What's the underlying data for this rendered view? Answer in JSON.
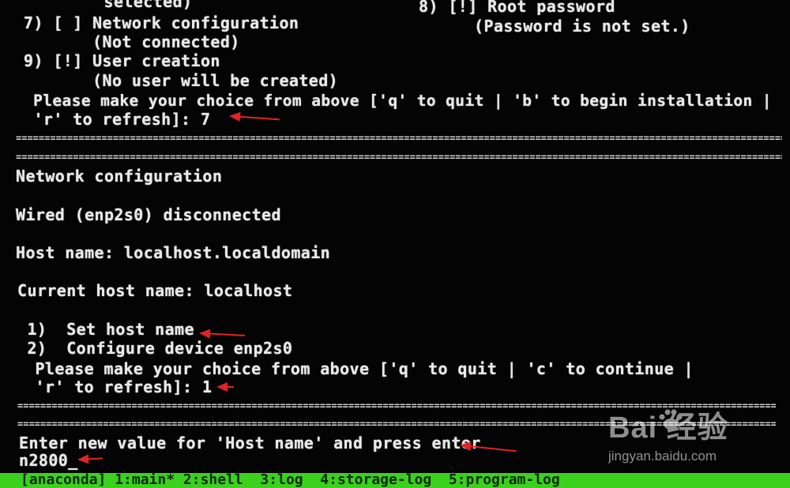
{
  "terminal": {
    "lines": {
      "l0_left": "        selected)",
      "l0_right": "8) [!] Root password",
      "l1": "7) [ ] Network configuration",
      "l1_right": "(Password is not set.)",
      "l2": "       (Not connected)",
      "l3": "9) [!] User creation",
      "l4": "       (No user will be created)",
      "l5": " Please make your choice from above ['q' to quit | 'b' to begin installation |",
      "l6": " 'r' to refresh]: 7",
      "l7": "Network configuration",
      "l8": "Wired (enp2s0) disconnected",
      "l9": "Host name: localhost.localdomain",
      "l10": "Current host name: localhost",
      "l11": " 1)  Set host name",
      "l12": " 2)  Configure device enp2s0",
      "l13": " Please make your choice from above ['q' to quit | 'c' to continue |",
      "l14": " 'r' to refresh]: 1",
      "l15": "Enter new value for 'Host name' and press enter",
      "l16": "n2800_"
    },
    "separator": "================================================================================================================================================================"
  },
  "statusbar": {
    "tabs": [
      "[anaconda] 1:main* 2:shell  3:log  4:storage-log  5:program-log"
    ]
  },
  "watermark": {
    "logo_text": "Bai  经验",
    "url": "jingyan.baidu.com"
  },
  "colors": {
    "terminal_bg": "#040404",
    "terminal_fg": "#e9e9e9",
    "statusbar_bg": "#3bd11e",
    "annotation_arrow": "#e02424"
  }
}
